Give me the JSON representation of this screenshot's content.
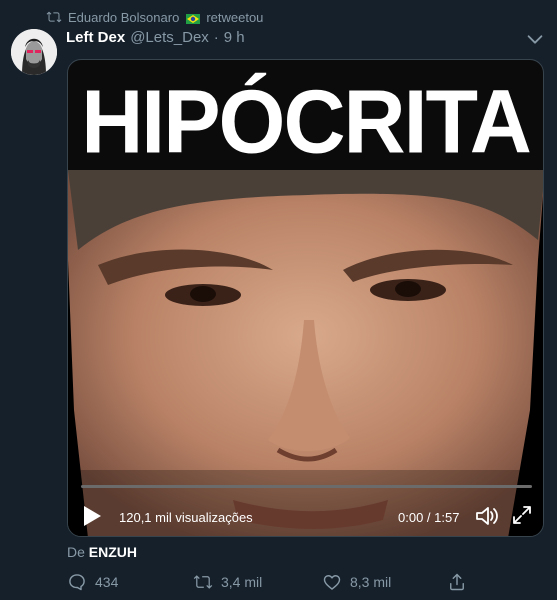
{
  "retweet": {
    "user": "Eduardo Bolsonaro",
    "action": "retweetou"
  },
  "author": {
    "name": "Left Dex",
    "handle": "@Lets_Dex",
    "separator": "·",
    "time": "9 h"
  },
  "media": {
    "overlay_text": "HIPÓCRITA",
    "views": "120,1 mil visualizações",
    "time": "0:00 / 1:57",
    "progress": 0
  },
  "source": {
    "prefix": "De",
    "name": "ENZUH"
  },
  "actions": {
    "replies": "434",
    "retweets": "3,4 mil",
    "likes": "8,3 mil"
  },
  "colors": {
    "background": "#15202b",
    "muted": "#8899a6",
    "text": "#ffffff"
  },
  "icons": [
    "retweet-icon",
    "brazil-flag-icon",
    "chevron-down-icon",
    "play-icon",
    "volume-icon",
    "fullscreen-icon",
    "reply-icon",
    "like-icon",
    "share-icon"
  ]
}
